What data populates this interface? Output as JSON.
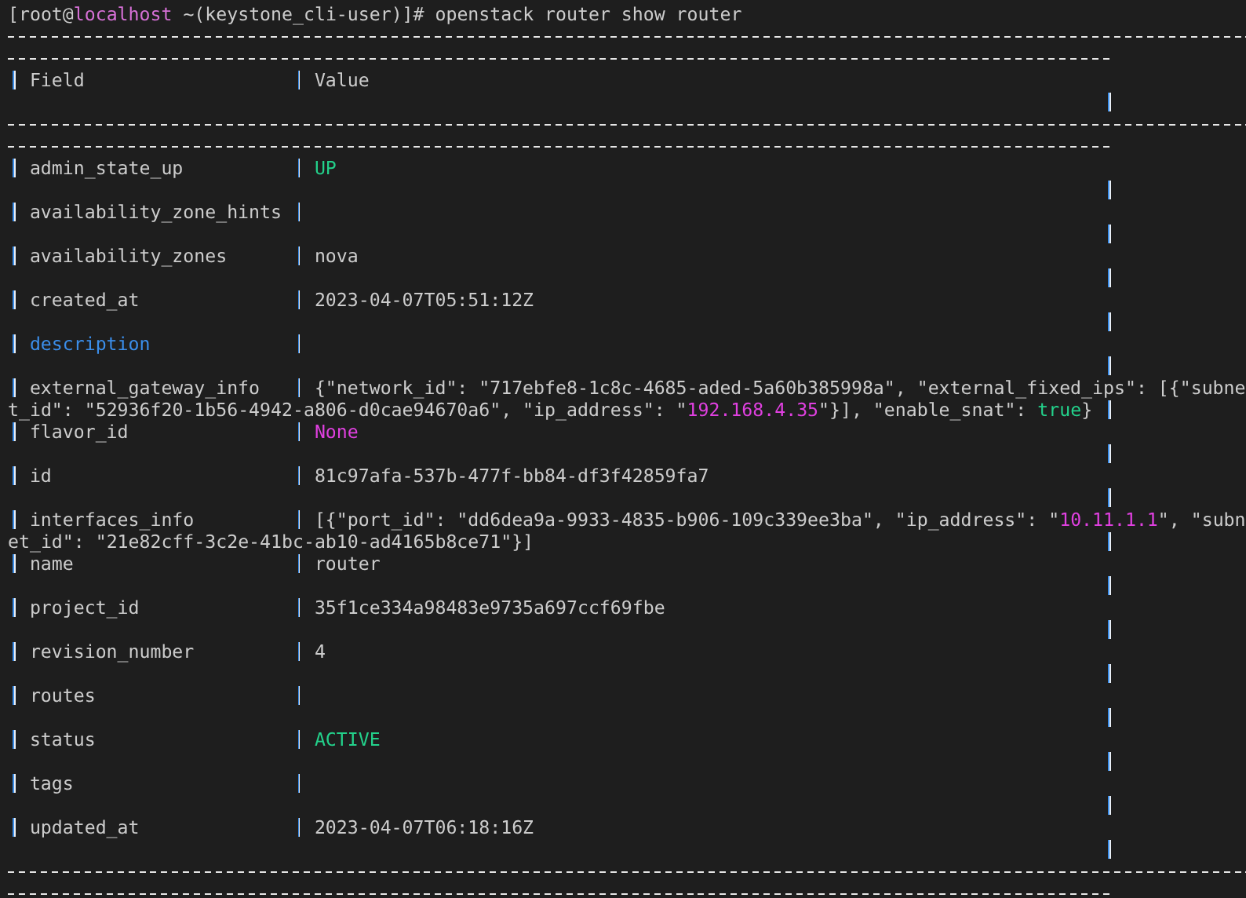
{
  "prompt": [
    {
      "text": "[root@",
      "kind": "plain"
    },
    {
      "text": "localhost",
      "kind": "host"
    },
    {
      "text": " ~(keystone_cli-user)]#",
      "kind": "plain"
    }
  ],
  "command": "openstack router show router",
  "table": {
    "columns": [
      "Field",
      "Value"
    ],
    "rows": [
      {
        "field": "admin_state_up",
        "highlighted": false,
        "value": [
          [
            {
              "text": "UP",
              "kind": "keyword"
            }
          ]
        ]
      },
      {
        "field": "availability_zone_hints",
        "highlighted": false
      },
      {
        "field": "availability_zones",
        "highlighted": false,
        "value": [
          [
            {
              "text": "nova",
              "kind": "plain"
            }
          ]
        ]
      },
      {
        "field": "created_at",
        "highlighted": false,
        "value": [
          [
            {
              "text": "2023-04-07T05:51:12Z",
              "kind": "plain"
            }
          ]
        ]
      },
      {
        "field": "description",
        "highlighted": true
      },
      {
        "field": "external_gateway_info",
        "highlighted": false,
        "value": [
          [
            {
              "text": "{\"network_id\": \"717ebfe8-1c8c-4685-aded-5a60b385998a\", \"external_fixed_ips\": [{\"subne",
              "kind": "plain"
            }
          ],
          [
            {
              "text": "t_id\": \"52936f20-1b56-4942-a806-d0cae94670a6\", \"ip_address\": \"",
              "kind": "plain"
            },
            {
              "text": "192.168.4.35",
              "kind": "literal"
            },
            {
              "text": "\"}], \"enable_snat\": ",
              "kind": "plain"
            },
            {
              "text": "true",
              "kind": "keyword"
            },
            {
              "text": "}",
              "kind": "plain"
            }
          ]
        ]
      },
      {
        "field": "flavor_id",
        "highlighted": false,
        "value": [
          [
            {
              "text": "None",
              "kind": "literal"
            }
          ]
        ]
      },
      {
        "field": "id",
        "highlighted": false,
        "value": [
          [
            {
              "text": "81c97afa-537b-477f-bb84-df3f42859fa7",
              "kind": "plain"
            }
          ]
        ]
      },
      {
        "field": "interfaces_info",
        "highlighted": false,
        "value": [
          [
            {
              "text": "[{\"port_id\": \"dd6dea9a-9933-4835-b906-109c339ee3ba\", \"ip_address\": \"",
              "kind": "plain"
            },
            {
              "text": "10.11.1.1",
              "kind": "literal"
            },
            {
              "text": "\", \"subn",
              "kind": "plain"
            }
          ],
          [
            {
              "text": "et_id\": \"21e82cff-3c2e-41bc-ab10-ad4165b8ce71\"}]",
              "kind": "plain"
            }
          ]
        ]
      },
      {
        "field": "name",
        "highlighted": false,
        "value": [
          [
            {
              "text": "router",
              "kind": "plain"
            }
          ]
        ]
      },
      {
        "field": "project_id",
        "highlighted": false,
        "value": [
          [
            {
              "text": "35f1ce334a98483e9735a697ccf69fbe",
              "kind": "plain"
            }
          ]
        ]
      },
      {
        "field": "revision_number",
        "highlighted": false,
        "value": [
          [
            {
              "text": "4",
              "kind": "plain"
            }
          ]
        ]
      },
      {
        "field": "routes",
        "highlighted": false
      },
      {
        "field": "status",
        "highlighted": false,
        "value": [
          [
            {
              "text": "ACTIVE",
              "kind": "keyword"
            }
          ]
        ]
      },
      {
        "field": "tags",
        "highlighted": false
      },
      {
        "field": "updated_at",
        "highlighted": false,
        "value": [
          [
            {
              "text": "2023-04-07T06:18:16Z",
              "kind": "plain"
            }
          ]
        ]
      }
    ]
  }
}
